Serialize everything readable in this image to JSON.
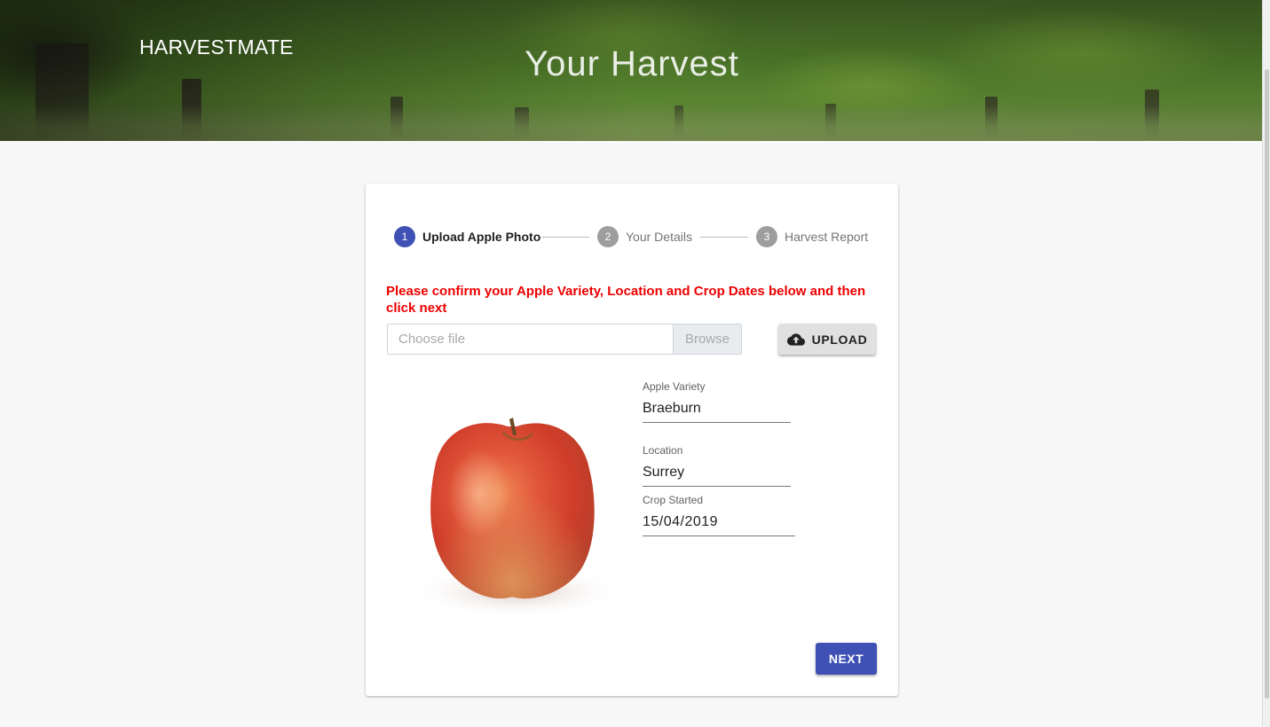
{
  "header": {
    "brand": "HARVESTMATE",
    "title": "Your Harvest"
  },
  "stepper": {
    "steps": [
      {
        "number": "1",
        "label": "Upload Apple Photo",
        "active": true
      },
      {
        "number": "2",
        "label": "Your Details",
        "active": false
      },
      {
        "number": "3",
        "label": "Harvest Report",
        "active": false
      }
    ]
  },
  "instruction": "Please confirm your Apple Variety, Location and Crop Dates below and then click next",
  "file_chooser": {
    "placeholder": "Choose file",
    "browse_label": "Browse"
  },
  "upload_button": {
    "label": "UPLOAD",
    "icon": "cloud-upload-icon"
  },
  "fields": {
    "variety": {
      "label": "Apple Variety",
      "value": "Braeburn"
    },
    "location": {
      "label": "Location",
      "value": "Surrey"
    },
    "crop_started": {
      "label": "Crop Started",
      "value": "15/04/2019"
    }
  },
  "next_button": {
    "label": "NEXT"
  },
  "colors": {
    "primary": "#3f51b5",
    "instruction": "#ee0000",
    "inactive_step": "#9e9e9e"
  }
}
